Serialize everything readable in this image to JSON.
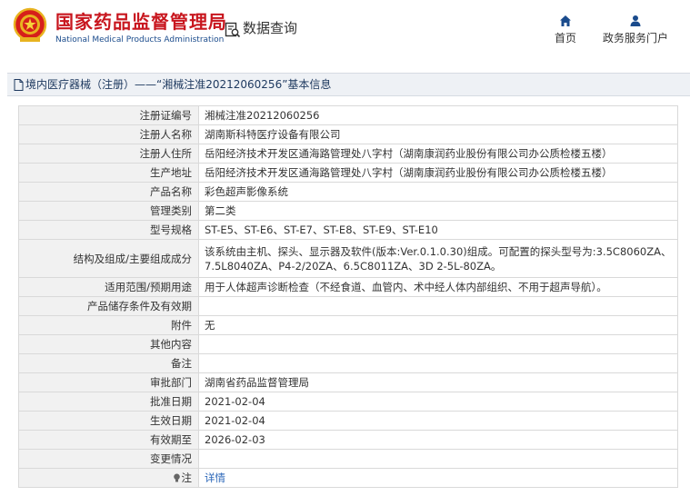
{
  "header": {
    "logo_cn": "国家药品监督管理局",
    "logo_en": "National Medical Products Administration",
    "query_title": "数据查询",
    "nav": [
      {
        "label": "首页",
        "icon": "home-icon"
      },
      {
        "label": "政务服务门户",
        "icon": "user-icon"
      }
    ]
  },
  "title_bar": {
    "text": "境内医疗器械（注册）——“湘械注准20212060256”基本信息"
  },
  "info": {
    "rows": [
      {
        "label": "注册证编号",
        "value": "湘械注准20212060256"
      },
      {
        "label": "注册人名称",
        "value": "湖南斯科特医疗设备有限公司"
      },
      {
        "label": "注册人住所",
        "value": "岳阳经济技术开发区通海路管理处八字村（湖南康润药业股份有限公司办公质检楼五楼）"
      },
      {
        "label": "生产地址",
        "value": "岳阳经济技术开发区通海路管理处八字村（湖南康润药业股份有限公司办公质检楼五楼）"
      },
      {
        "label": "产品名称",
        "value": "彩色超声影像系统"
      },
      {
        "label": "管理类别",
        "value": "第二类"
      },
      {
        "label": "型号规格",
        "value": "ST-E5、ST-E6、ST-E7、ST-E8、ST-E9、ST-E10"
      },
      {
        "label": "结构及组成/主要组成成分",
        "value": "该系统由主机、探头、显示器及软件(版本:Ver.0.1.0.30)组成。可配置的探头型号为:3.5C8060ZA、7.5L8040ZA、P4-2/20ZA、6.5C8011ZA、3D 2-5L-80ZA。"
      },
      {
        "label": "适用范围/预期用途",
        "value": "用于人体超声诊断检查（不经食道、血管内、术中经人体内部组织、不用于超声导航）。"
      },
      {
        "label": "产品储存条件及有效期",
        "value": ""
      },
      {
        "label": "附件",
        "value": "无"
      },
      {
        "label": "其他内容",
        "value": ""
      },
      {
        "label": "备注",
        "value": ""
      },
      {
        "label": "审批部门",
        "value": "湖南省药品监督管理局"
      },
      {
        "label": "批准日期",
        "value": "2021-02-04"
      },
      {
        "label": "生效日期",
        "value": "2021-02-04"
      },
      {
        "label": "有效期至",
        "value": "2026-02-03"
      },
      {
        "label": "变更情况",
        "value": ""
      }
    ],
    "note": {
      "label": "注",
      "link": "详情",
      "icon": "bulb-icon"
    }
  }
}
